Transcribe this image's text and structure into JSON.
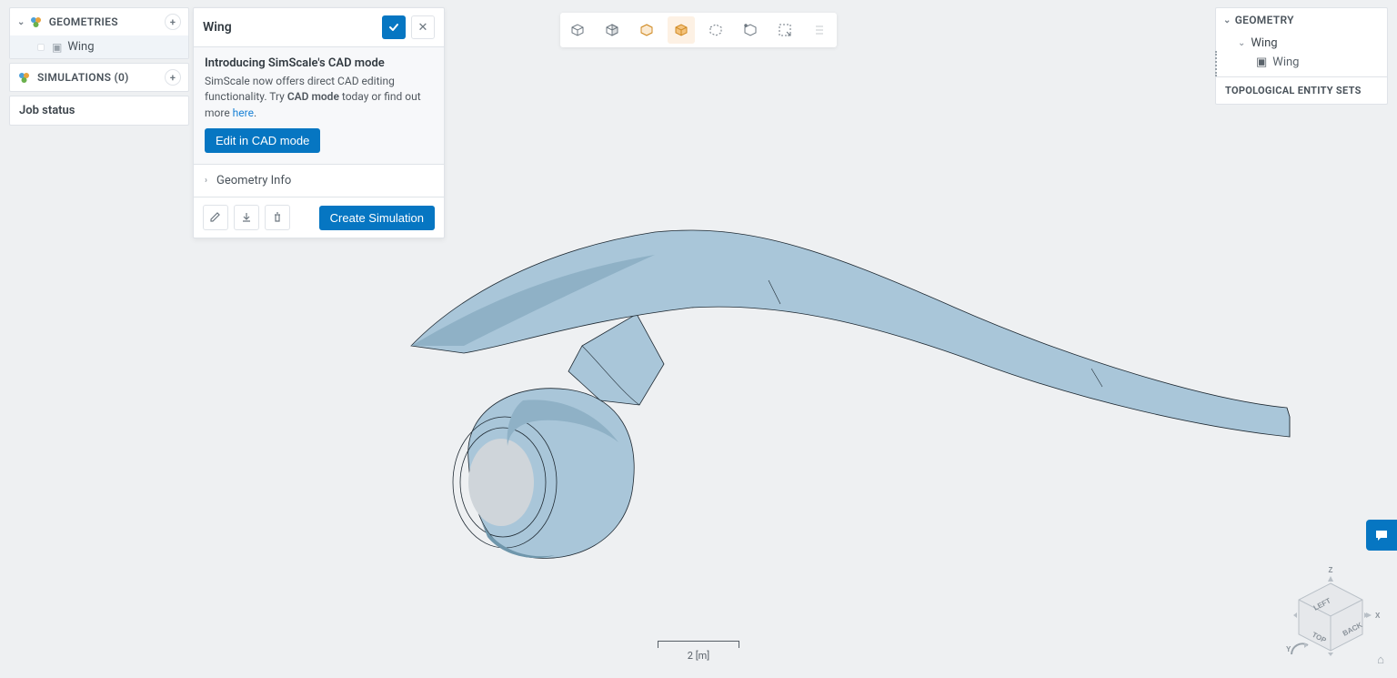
{
  "left": {
    "geometries_label": "GEOMETRIES",
    "wing": "Wing",
    "simulations_label": "SIMULATIONS (0)",
    "job_status": "Job status"
  },
  "detail": {
    "title": "Wing",
    "intro_heading": "Introducing SimScale's CAD mode",
    "intro_text_1": "SimScale now offers direct CAD editing functionality. Try ",
    "intro_bold": "CAD mode",
    "intro_text_2": " today or find out more ",
    "intro_link": "here",
    "intro_text_3": ".",
    "edit_btn": "Edit in CAD mode",
    "geometry_info": "Geometry Info",
    "create_sim": "Create Simulation"
  },
  "right": {
    "geometry_label": "GEOMETRY",
    "wing": "Wing",
    "wing_child": "Wing",
    "top_sets": "TOPOLOGICAL ENTITY SETS"
  },
  "scale": {
    "label": "2 [m]"
  }
}
